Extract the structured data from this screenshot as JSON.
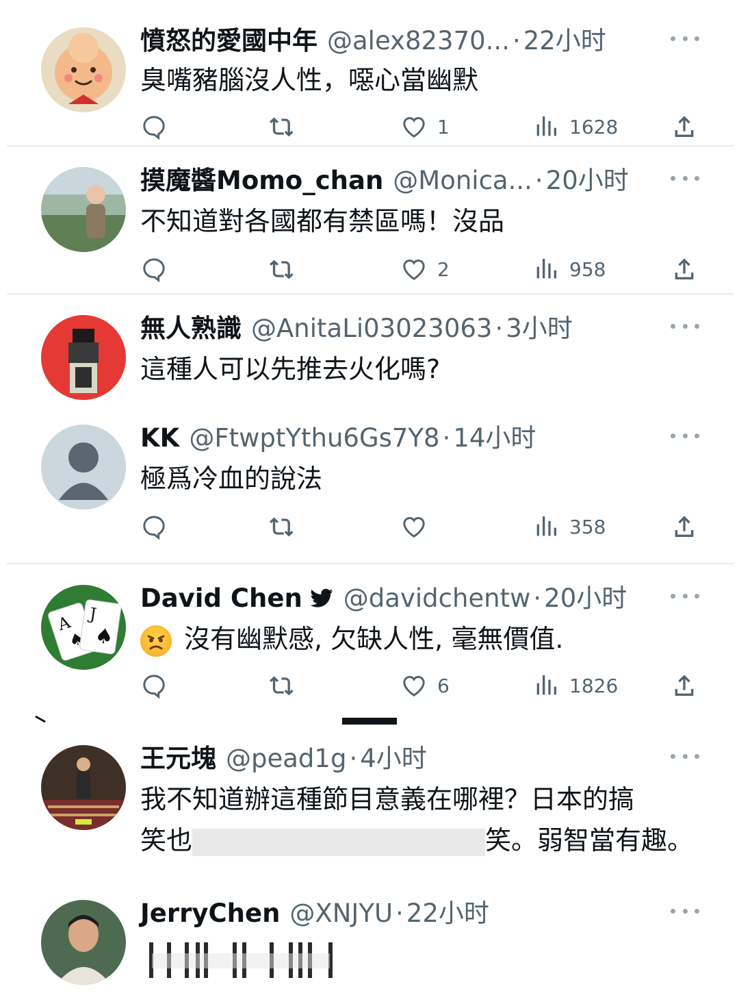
{
  "tweets": [
    {
      "name": "憤怒的愛國中年",
      "handle": "@alex82370...",
      "sep": "·",
      "time": "22小时",
      "text": "臭嘴豬腦沒人性，噁心當幽默",
      "actions": {
        "reply": "",
        "retweet": "",
        "like": "1",
        "views": "1628"
      },
      "avatar_color": "#f1e2c8"
    },
    {
      "name": "摸魔醬Momo_chan",
      "handle": "@Monica...",
      "sep": "·",
      "time": "20小时",
      "text": "不知道對各國都有禁區嗎！沒品",
      "actions": {
        "reply": "",
        "retweet": "",
        "like": "2",
        "views": "958"
      },
      "avatar_color": "#7c9c7e"
    },
    {
      "name": "無人熟識",
      "handle": "@AnitaLi03023063",
      "sep": "·",
      "time": "3小时",
      "text": "這種人可以先推去火化嗎?",
      "avatar_color": "#e53935"
    },
    {
      "name": "KK",
      "handle": "@FtwptYthu6Gs7Y8",
      "sep": "·",
      "time": "14小时",
      "text": "極爲冷血的說法",
      "actions": {
        "reply": "",
        "retweet": "",
        "like": "",
        "views": "358"
      },
      "avatar_color": "#ccd6dd"
    },
    {
      "name": "David Chen",
      "handle": "@davidchentw",
      "sep": "·",
      "time": "20小时",
      "emoji": "angry-face",
      "text": "沒有幽默感, 欠缺人性, 毫無價值.",
      "actions": {
        "reply": "",
        "retweet": "",
        "like": "6",
        "views": "1826"
      },
      "avatar_color": "#2e7d32"
    },
    {
      "name": "王元塊",
      "handle": "@pead1g",
      "sep": "·",
      "time": "4小时",
      "text": "我不知道辦這種節目意義在哪裡？日本的搞",
      "text2_start": "笑也",
      "text2_end": "笑。弱智當有趣。",
      "avatar_color": "#5d4037"
    },
    {
      "name": "JerryChen",
      "handle": "@XNJYU",
      "sep": "·",
      "time": "22小时",
      "avatar_color": "#4e6b52"
    }
  ],
  "icons": [
    "reply-icon",
    "retweet-icon",
    "like-icon",
    "views-icon",
    "share-icon",
    "more-icon",
    "verified-bird-icon"
  ],
  "colors": {
    "text": "#0f1419",
    "secondary": "#536471",
    "divider": "#e8ecef"
  }
}
